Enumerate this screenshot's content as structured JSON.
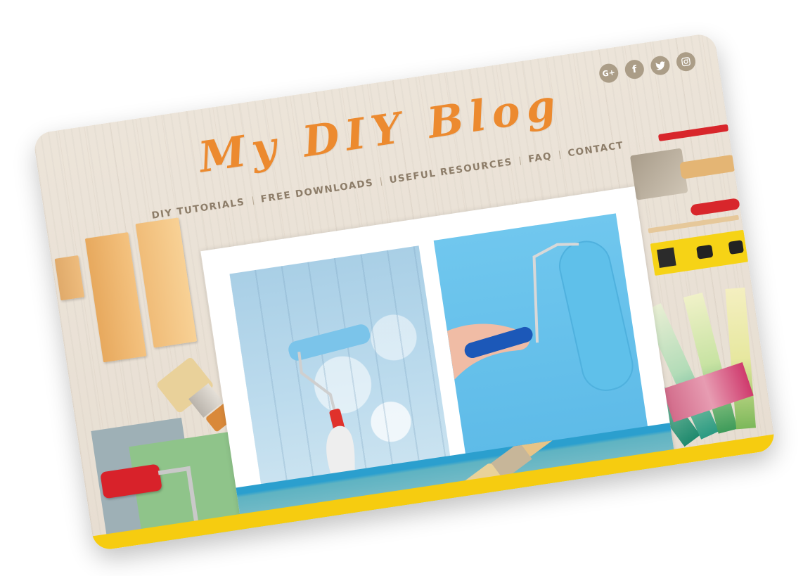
{
  "site": {
    "logo": "My DIY Blog"
  },
  "social": [
    {
      "name": "google-plus",
      "label": "G+"
    },
    {
      "name": "facebook",
      "label": "f"
    },
    {
      "name": "twitter",
      "label": ""
    },
    {
      "name": "instagram",
      "label": ""
    }
  ],
  "nav": [
    {
      "label": "DIY TUTORIALS"
    },
    {
      "label": "FREE DOWNLOADS"
    },
    {
      "label": "USEFUL RESOURCES"
    },
    {
      "label": "FAQ"
    },
    {
      "label": "CONTACT"
    }
  ],
  "colors": {
    "logo": "#ec8a2f",
    "nav_text": "#8d7d69",
    "social_bg": "#ab9d87",
    "accent_band": "#f6cc10",
    "paint_blue": "#5ebbe8"
  },
  "photos": [
    {
      "name": "wall-paint-roller-photo"
    },
    {
      "name": "paint-roller-hands-photo"
    },
    {
      "name": "paint-brush-photo"
    }
  ]
}
